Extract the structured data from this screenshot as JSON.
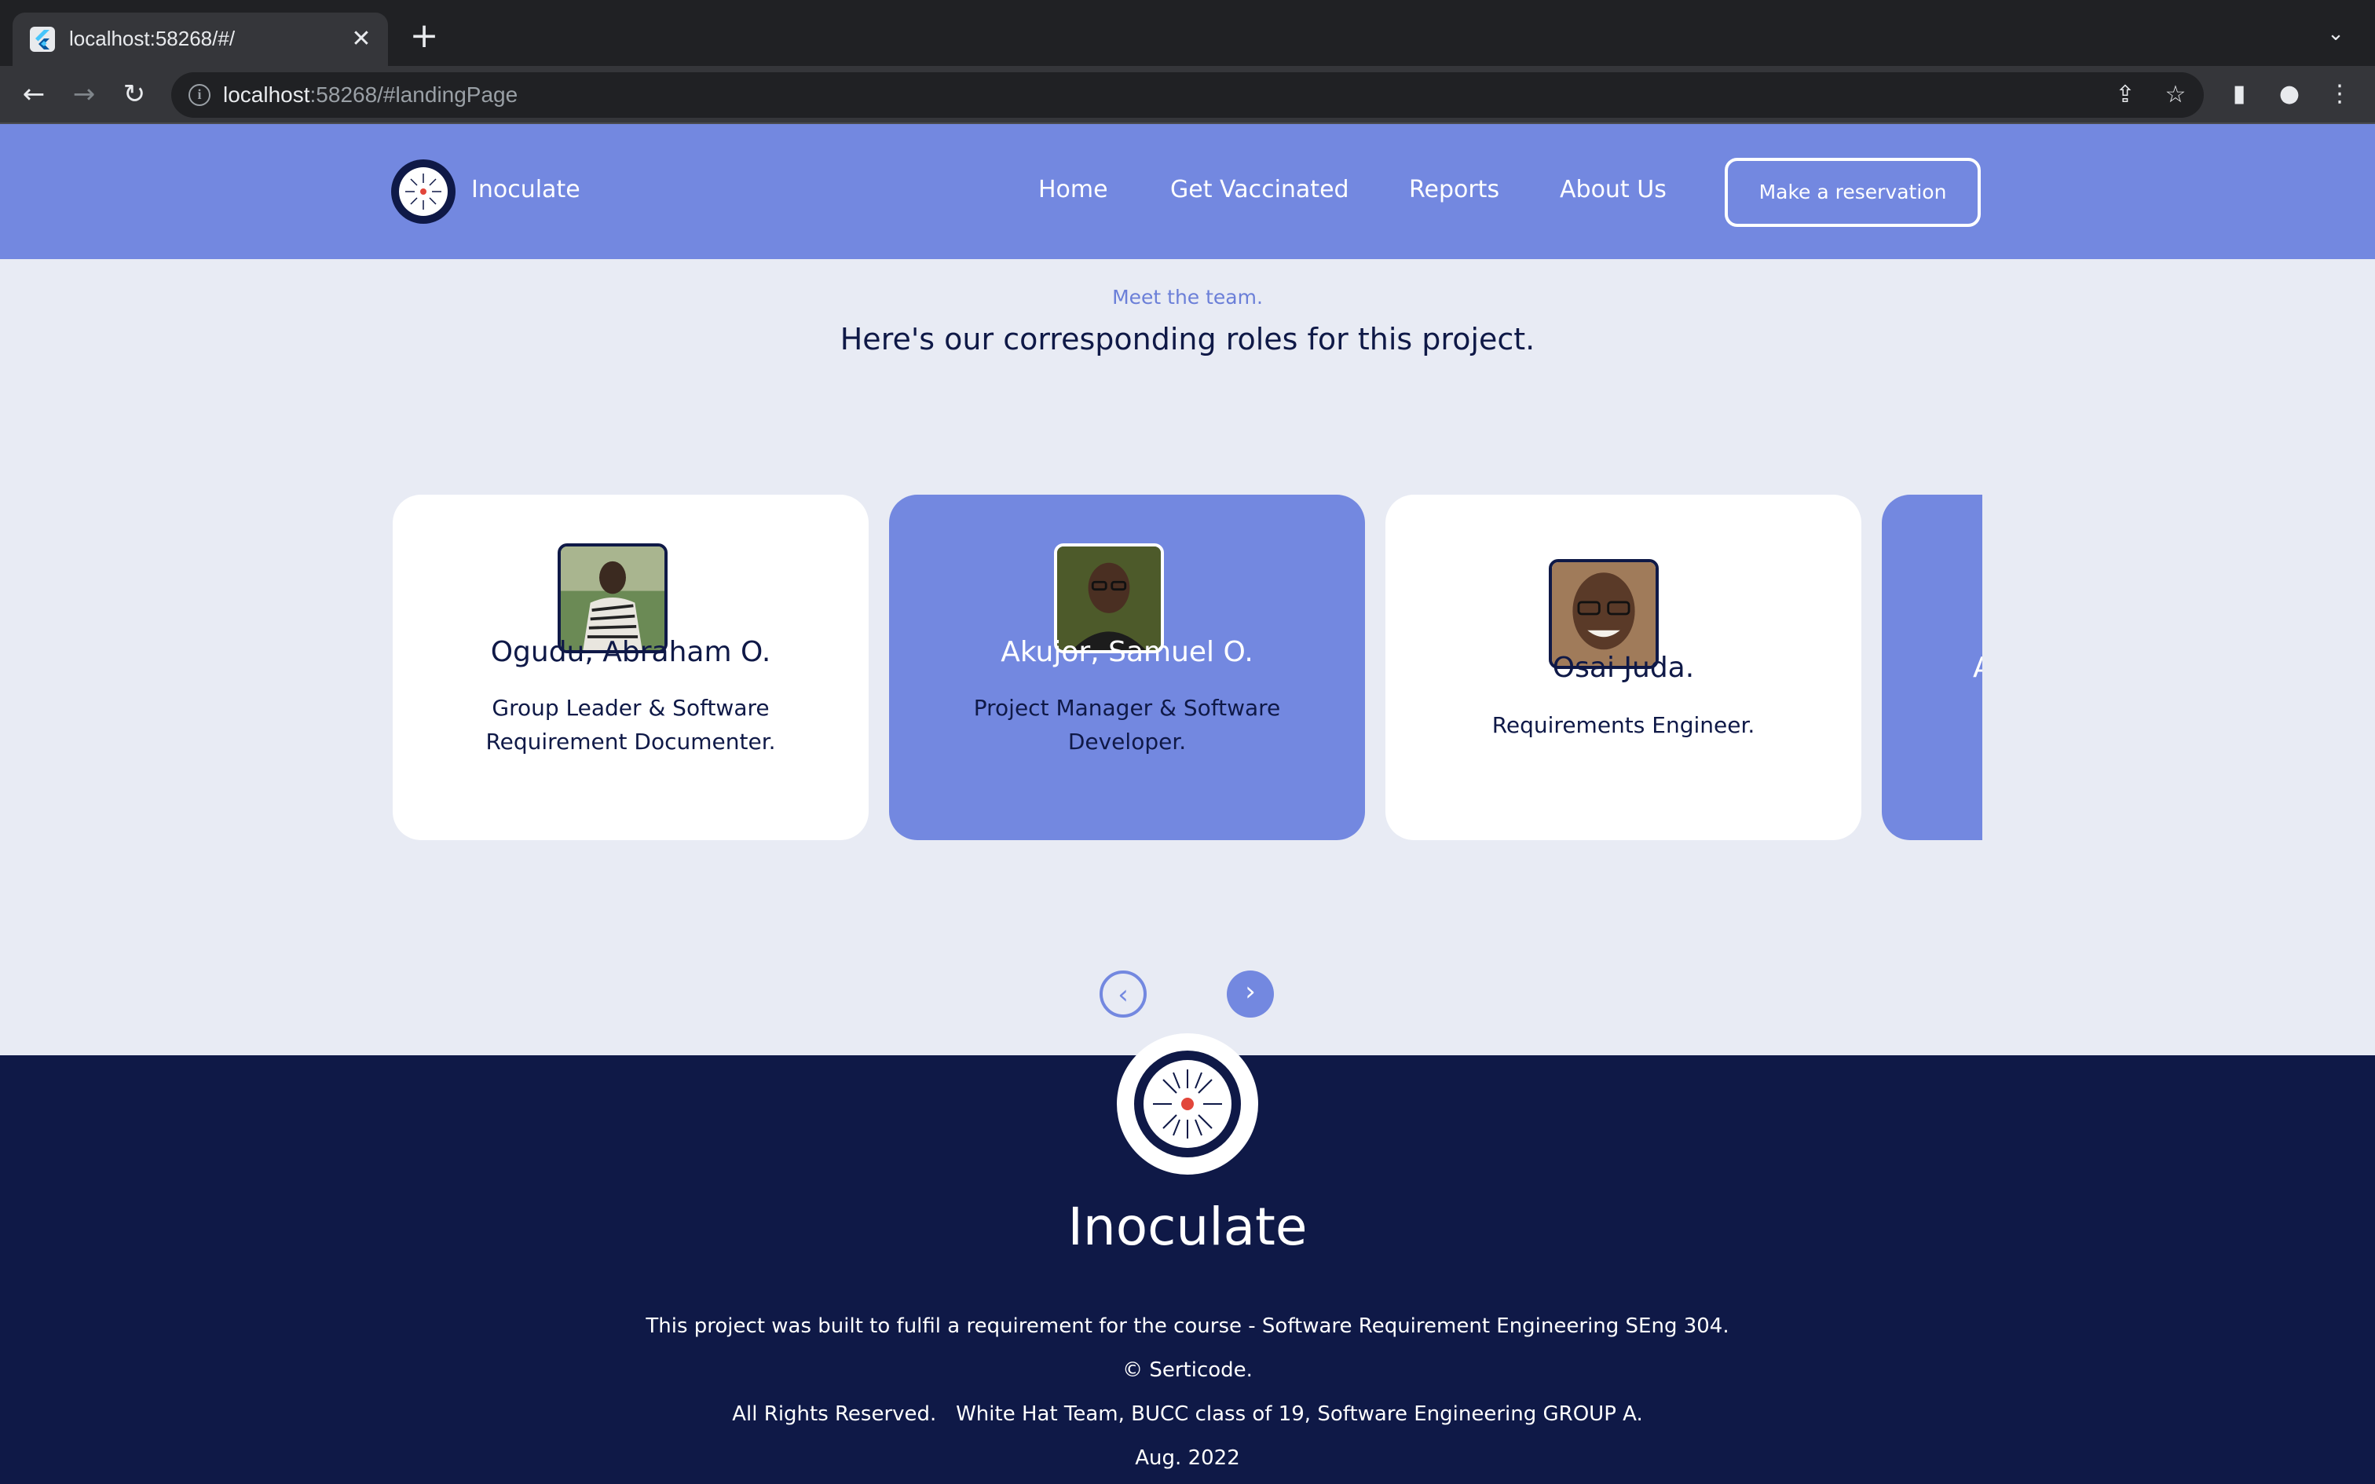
{
  "browser": {
    "tab_title": "localhost:58268/#/",
    "tab_close": "✕",
    "new_tab": "+",
    "url_host": "localhost",
    "url_rest": ":58268/#landingPage"
  },
  "nav": {
    "brand": "Inoculate",
    "links": [
      "Home",
      "Get Vaccinated",
      "Reports",
      "About Us"
    ],
    "cta": "Make a reservation"
  },
  "team": {
    "kicker": "Meet the team.",
    "title": "Here's our corresponding roles for this project.",
    "members": [
      {
        "name": "Ogudu, Abraham O.",
        "role": "Group Leader & Software Requirement Documenter."
      },
      {
        "name": "Akujor, Samuel O.",
        "role": "Project Manager & Software Developer."
      },
      {
        "name": "Osai Juda.",
        "role": "Requirements Engineer."
      }
    ],
    "partial_card_letter": "A"
  },
  "carousel": {
    "prev_icon": "chevron-left-icon",
    "next_icon": "chevron-right-icon"
  },
  "footer": {
    "brand": "Inoculate",
    "line1": "This project was built to fulfil a requirement for the course - Software Requirement Engineering SEng 304.",
    "line2": "© Serticode.",
    "line3": "All Rights Reserved.   White Hat Team, BUCC class of 19, Software Engineering GROUP A.",
    "line4": "Aug. 2022"
  },
  "colors": {
    "primary": "#7388e0",
    "navy": "#0f1947",
    "background": "#e8ebf4"
  }
}
